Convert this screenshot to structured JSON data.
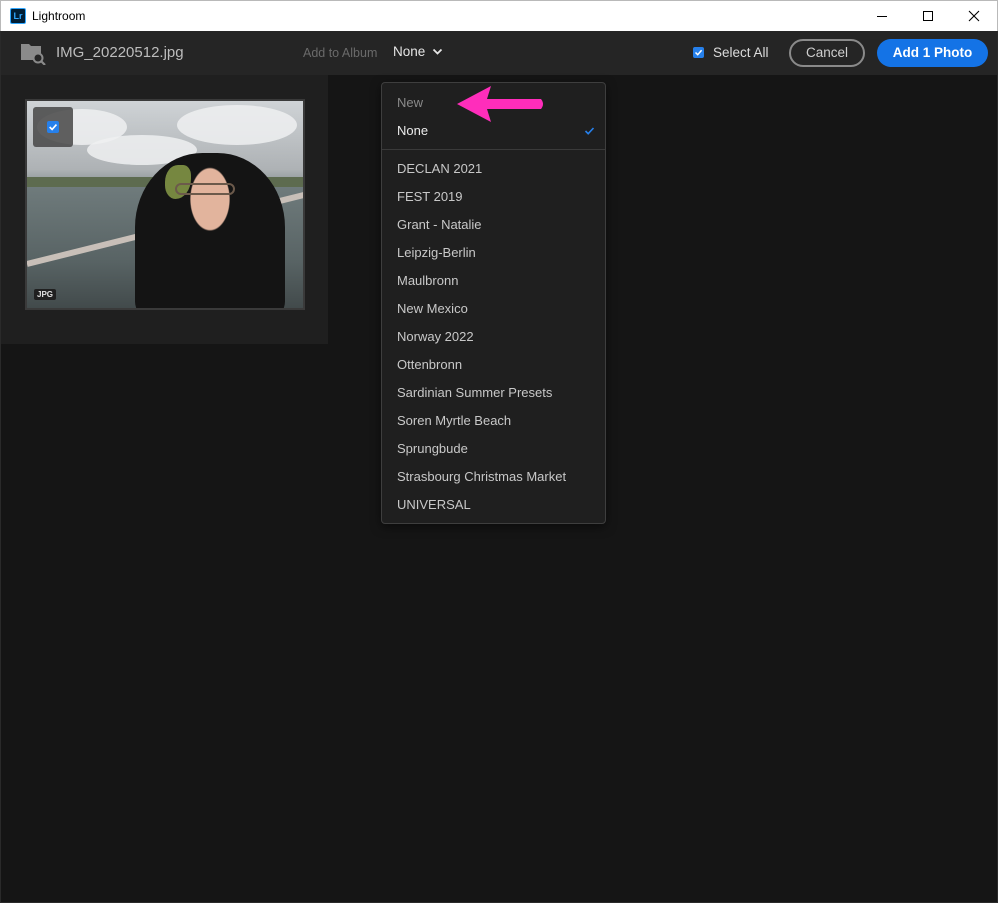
{
  "window": {
    "title": "Lightroom",
    "logo_text": "Lr"
  },
  "toolbar": {
    "file_name": "IMG_20220512.jpg",
    "album_label": "Add to Album",
    "album_value": "None",
    "select_all_label": "Select All",
    "select_all_checked": true,
    "cancel_label": "Cancel",
    "add_label": "Add 1 Photo"
  },
  "grid": {
    "items": [
      {
        "badge": "JPG",
        "checked": true
      }
    ]
  },
  "dropdown": {
    "new_label": "New",
    "none_label": "None",
    "albums": [
      "DECLAN 2021",
      "FEST 2019",
      "Grant - Natalie",
      "Leipzig-Berlin",
      "Maulbronn",
      "New Mexico",
      "Norway 2022",
      "Ottenbronn",
      "Sardinian Summer Presets",
      "Soren Myrtle Beach",
      "Sprungbude",
      "Strasbourg Christmas Market",
      "UNIVERSAL"
    ]
  },
  "colors": {
    "accent": "#1473e6",
    "checkbox": "#2680eb",
    "annotation_arrow": "#ff2dbb"
  }
}
